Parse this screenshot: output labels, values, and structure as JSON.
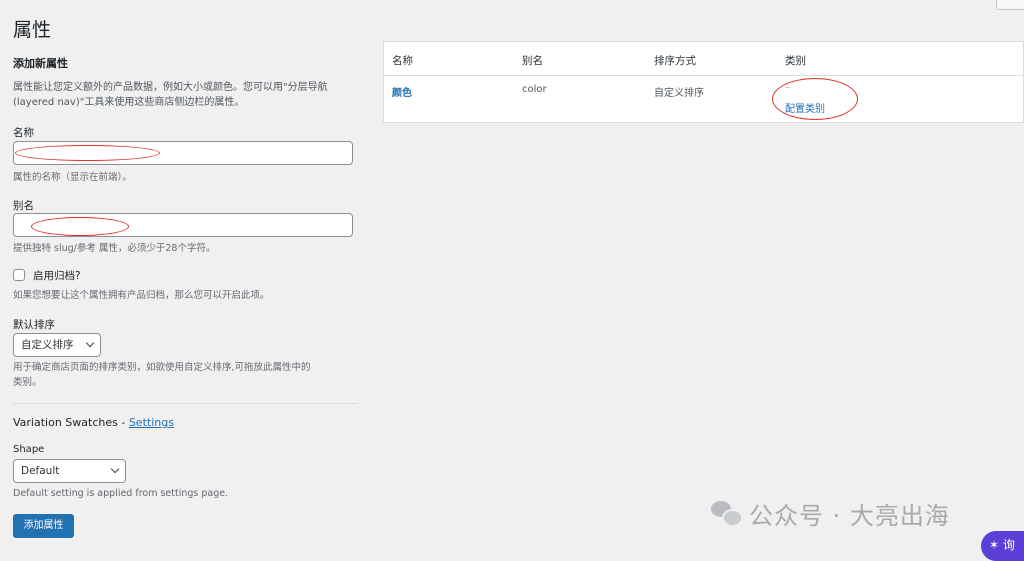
{
  "page": {
    "title": "属性"
  },
  "form": {
    "section_title": "添加新属性",
    "intro_line1": "属性能让您定义额外的产品数据，例如大小或颜色。您可以用\"分层导航",
    "intro_line2": "(layered nav)\"工具来使用这些商店侧边栏的属性。",
    "name_label": "名称",
    "name_value": "",
    "name_help": "属性的名称（显示在前端）。",
    "slug_label": "别名",
    "slug_value": "",
    "slug_help": "提供独特 slug/参考 属性，必须少于28个字符。",
    "archive_label": "启用归档?",
    "archive_checked": false,
    "archive_help": "如果您想要让这个属性拥有产品归档，那么您可以开启此项。",
    "orderby_label": "默认排序",
    "orderby_value": "自定义排序",
    "orderby_help_line1": "用于确定商店页面的排序类别，如欲使用自定义排序,可拖放此属性中的",
    "orderby_help_line2": "类别。",
    "vs_title": "Variation Swatches - ",
    "vs_settings_link": "Settings",
    "shape_label": "Shape",
    "shape_value": "Default",
    "shape_help": "Default setting is applied from settings page.",
    "submit_label": "添加属性"
  },
  "table": {
    "headers": [
      "名称",
      "别名",
      "排序方式",
      "类别"
    ],
    "rows": [
      {
        "name": "颜色",
        "slug": "color",
        "orderby": "自定义排序",
        "terms": "–",
        "configure": "配置类别"
      }
    ]
  },
  "watermark": {
    "text": "公众号 · 大亮出海",
    "icon": "wechat-icon"
  },
  "floating_button": {
    "label": "询"
  },
  "colors": {
    "link": "#2271b1",
    "primary": "#2271b1",
    "annotation": "#e0332b",
    "background": "#f0f0f1"
  }
}
